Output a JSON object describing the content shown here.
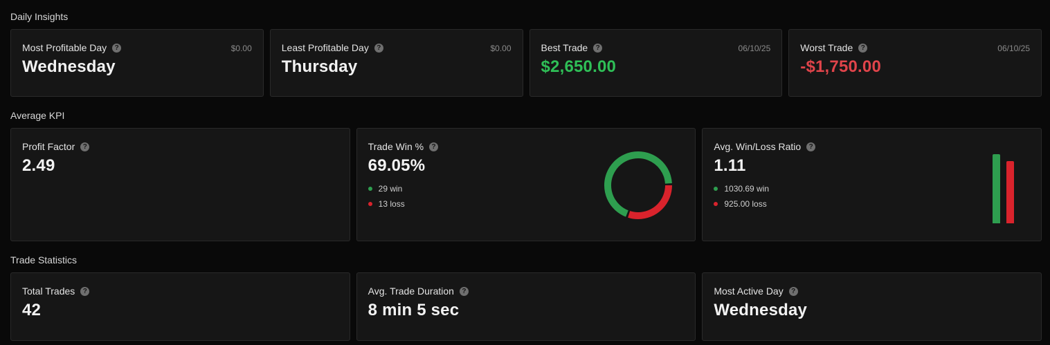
{
  "sections": {
    "daily_insights": "Daily Insights",
    "average_kpi": "Average KPI",
    "trade_statistics": "Trade Statistics"
  },
  "daily": {
    "most_profitable": {
      "label": "Most Profitable Day",
      "value": "Wednesday",
      "amount": "$0.00"
    },
    "least_profitable": {
      "label": "Least Profitable Day",
      "value": "Thursday",
      "amount": "$0.00"
    },
    "best_trade": {
      "label": "Best Trade",
      "value": "$2,650.00",
      "date": "06/10/25"
    },
    "worst_trade": {
      "label": "Worst Trade",
      "value": "-$1,750.00",
      "date": "06/10/25"
    }
  },
  "kpi": {
    "profit_factor": {
      "label": "Profit Factor",
      "value": "2.49"
    },
    "trade_win": {
      "label": "Trade Win %",
      "value": "69.05%",
      "win": "29 win",
      "loss": "13 loss",
      "win_count": 29,
      "loss_count": 13
    },
    "win_loss_ratio": {
      "label": "Avg. Win/Loss Ratio",
      "value": "1.11",
      "win": "1030.69 win",
      "loss": "925.00 loss",
      "win_amount": 1030.69,
      "loss_amount": 925.0
    }
  },
  "stats": {
    "total_trades": {
      "label": "Total Trades",
      "value": "42"
    },
    "avg_duration": {
      "label": "Avg. Trade Duration",
      "value": "8 min 5 sec"
    },
    "most_active": {
      "label": "Most Active Day",
      "value": "Wednesday"
    }
  },
  "help_glyph": "?",
  "colors": {
    "win": "#2e9e4f",
    "loss": "#d9232c",
    "positive_text": "#2fbf57",
    "negative_text": "#e0444a",
    "card_bg": "#161616",
    "page_bg": "#090909"
  },
  "icons": {
    "help": "question-circle-icon"
  }
}
